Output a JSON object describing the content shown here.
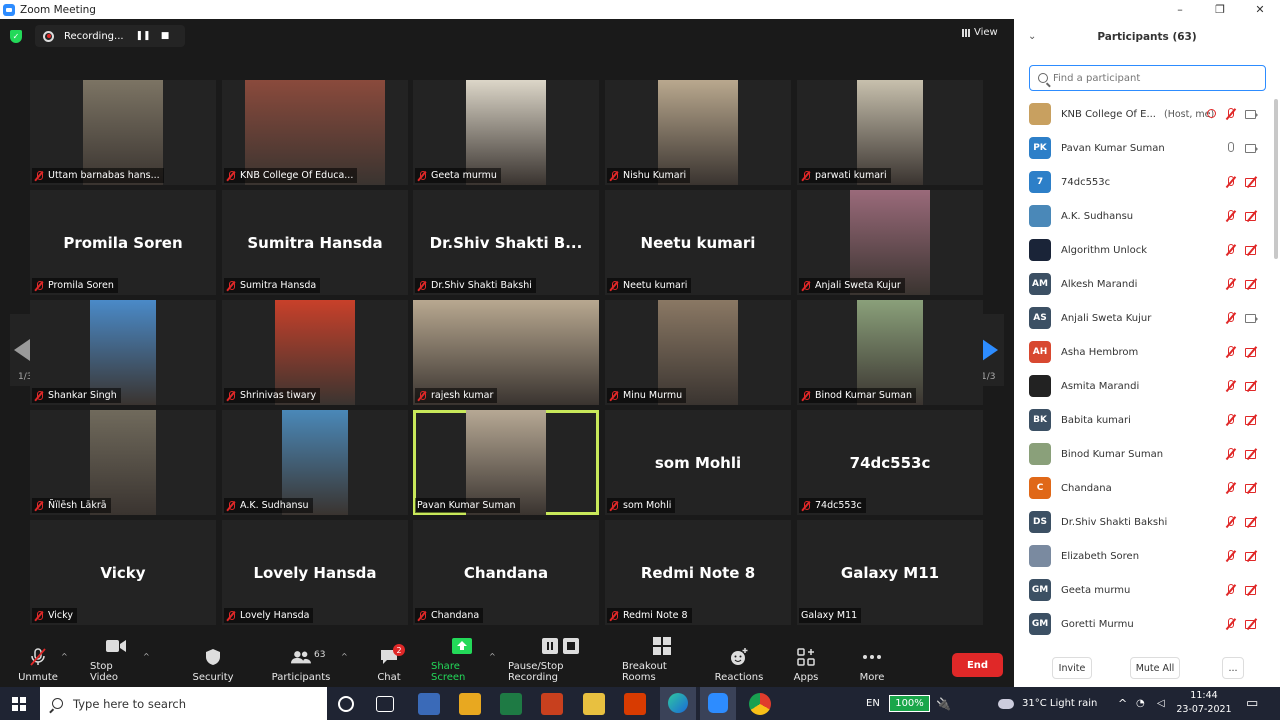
{
  "window": {
    "title": "Zoom Meeting",
    "minimize": "–",
    "maximize": "❐",
    "close": "✕"
  },
  "recording": {
    "label": "Recording...",
    "pause": "❚❚",
    "stop": "■"
  },
  "view_label": "View",
  "pager": {
    "left": "1/3",
    "right": "1/3"
  },
  "tiles": [
    {
      "label": "Uttam barnabas hans...",
      "big": "",
      "photo": "#7c7464"
    },
    {
      "label": "KNB College Of Educa...",
      "big": "",
      "photo": "#8a4a3c"
    },
    {
      "label": "Geeta murmu",
      "big": "",
      "photo": "#dcd6c8"
    },
    {
      "label": "Nishu Kumari",
      "big": "",
      "photo": "#b9a88e"
    },
    {
      "label": "parwati kumari",
      "big": "",
      "photo": "#c7c0ad"
    },
    {
      "label": "Promila Soren",
      "big": "Promila Soren",
      "photo": ""
    },
    {
      "label": "Sumitra Hansda",
      "big": "Sumitra Hansda",
      "photo": ""
    },
    {
      "label": "Dr.Shiv Shakti Bakshi",
      "big": "Dr.Shiv  Shakti  B...",
      "photo": ""
    },
    {
      "label": "Neetu kumari",
      "big": "Neetu kumari",
      "photo": ""
    },
    {
      "label": "Anjali Sweta Kujur",
      "big": "",
      "photo": "#9a6a7a"
    },
    {
      "label": "Shankar Singh",
      "big": "",
      "photo": "#4a8ac8"
    },
    {
      "label": "Shrinivas tiwary",
      "big": "",
      "photo": "#c8402a"
    },
    {
      "label": "rajesh kumar",
      "big": "",
      "photo": "#b8a890"
    },
    {
      "label": "Minu Murmu",
      "big": "",
      "photo": "#8a7864"
    },
    {
      "label": "Binod Kumar Suman",
      "big": "",
      "photo": "#8aa07a"
    },
    {
      "label": "Ñïlēsh Lākrā",
      "big": "",
      "photo": "#706a5c"
    },
    {
      "label": "A.K. Sudhansu",
      "big": "",
      "photo": "#4a88b8"
    },
    {
      "label": "Pavan Kumar Suman",
      "big": "",
      "photo": "#b6a894"
    },
    {
      "label": "som Mohli",
      "big": "som Mohli",
      "photo": ""
    },
    {
      "label": "74dc553c",
      "big": "74dc553c",
      "photo": ""
    },
    {
      "label": "Vicky",
      "big": "Vicky",
      "photo": ""
    },
    {
      "label": "Lovely Hansda",
      "big": "Lovely Hansda",
      "photo": ""
    },
    {
      "label": "Chandana",
      "big": "Chandana",
      "photo": ""
    },
    {
      "label": "Redmi Note 8",
      "big": "Redmi Note 8",
      "photo": ""
    },
    {
      "label": "Galaxy M11",
      "big": "Galaxy M11",
      "photo": ""
    }
  ],
  "toolbar": {
    "unmute": "Unmute",
    "stop_video": "Stop Video",
    "security": "Security",
    "participants": "Participants",
    "participants_count": "63",
    "chat": "Chat",
    "chat_badge": "2",
    "share_screen": "Share Screen",
    "pause_stop_recording": "Pause/Stop Recording",
    "breakout_rooms": "Breakout Rooms",
    "reactions": "Reactions",
    "apps": "Apps",
    "more": "More",
    "end": "End"
  },
  "panel": {
    "title": "Participants (63)",
    "search_placeholder": "Find a participant",
    "invite": "Invite",
    "mute_all": "Mute All",
    "more": "...",
    "participants": [
      {
        "name": "KNB College Of E...",
        "tag": "(Host, me)",
        "initials": "",
        "color": "#c8a060",
        "mic": "off",
        "cam": "on"
      },
      {
        "name": "Pavan Kumar Suman",
        "tag": "",
        "initials": "PK",
        "color": "#2d7fc8",
        "mic": "on",
        "cam": "on"
      },
      {
        "name": "74dc553c",
        "tag": "",
        "initials": "7",
        "color": "#2d7fc8",
        "mic": "off",
        "cam": "off"
      },
      {
        "name": "A.K. Sudhansu",
        "tag": "",
        "initials": "",
        "color": "#4a88b8",
        "mic": "off",
        "cam": "off"
      },
      {
        "name": "Algorithm Unlock",
        "tag": "",
        "initials": "",
        "color": "#1a2438",
        "mic": "off",
        "cam": "off"
      },
      {
        "name": "Alkesh Marandi",
        "tag": "",
        "initials": "AM",
        "color": "#3c5064",
        "mic": "off",
        "cam": "off"
      },
      {
        "name": "Anjali Sweta Kujur",
        "tag": "",
        "initials": "AS",
        "color": "#3c5064",
        "mic": "off",
        "cam": "on"
      },
      {
        "name": "Asha Hembrom",
        "tag": "",
        "initials": "AH",
        "color": "#d84830",
        "mic": "off",
        "cam": "off"
      },
      {
        "name": "Asmita Marandi",
        "tag": "",
        "initials": "",
        "color": "#222222",
        "mic": "off",
        "cam": "off"
      },
      {
        "name": "Babita kumari",
        "tag": "",
        "initials": "BK",
        "color": "#3c5064",
        "mic": "off",
        "cam": "off"
      },
      {
        "name": "Binod Kumar Suman",
        "tag": "",
        "initials": "",
        "color": "#8aa07a",
        "mic": "off",
        "cam": "off"
      },
      {
        "name": "Chandana",
        "tag": "",
        "initials": "C",
        "color": "#e06818",
        "mic": "off",
        "cam": "off"
      },
      {
        "name": "Dr.Shiv Shakti Bakshi",
        "tag": "",
        "initials": "DS",
        "color": "#3c5064",
        "mic": "off",
        "cam": "off"
      },
      {
        "name": "Elizabeth Soren",
        "tag": "",
        "initials": "",
        "color": "#7a8aa0",
        "mic": "off",
        "cam": "off"
      },
      {
        "name": "Geeta murmu",
        "tag": "",
        "initials": "GM",
        "color": "#3c5064",
        "mic": "off",
        "cam": "off"
      },
      {
        "name": "Goretti Murmu",
        "tag": "",
        "initials": "GM",
        "color": "#3c5064",
        "mic": "off",
        "cam": "off"
      }
    ]
  },
  "taskbar": {
    "search_text": "Type here to search",
    "language": "EN",
    "battery": "100%",
    "weather": "31°C  Light rain",
    "time": "11:44",
    "date": "23-07-2021"
  },
  "colors": {
    "accent": "#2d8cff",
    "end": "#e02828",
    "active_speaker": "#c8e85a",
    "share": "#23d959"
  }
}
